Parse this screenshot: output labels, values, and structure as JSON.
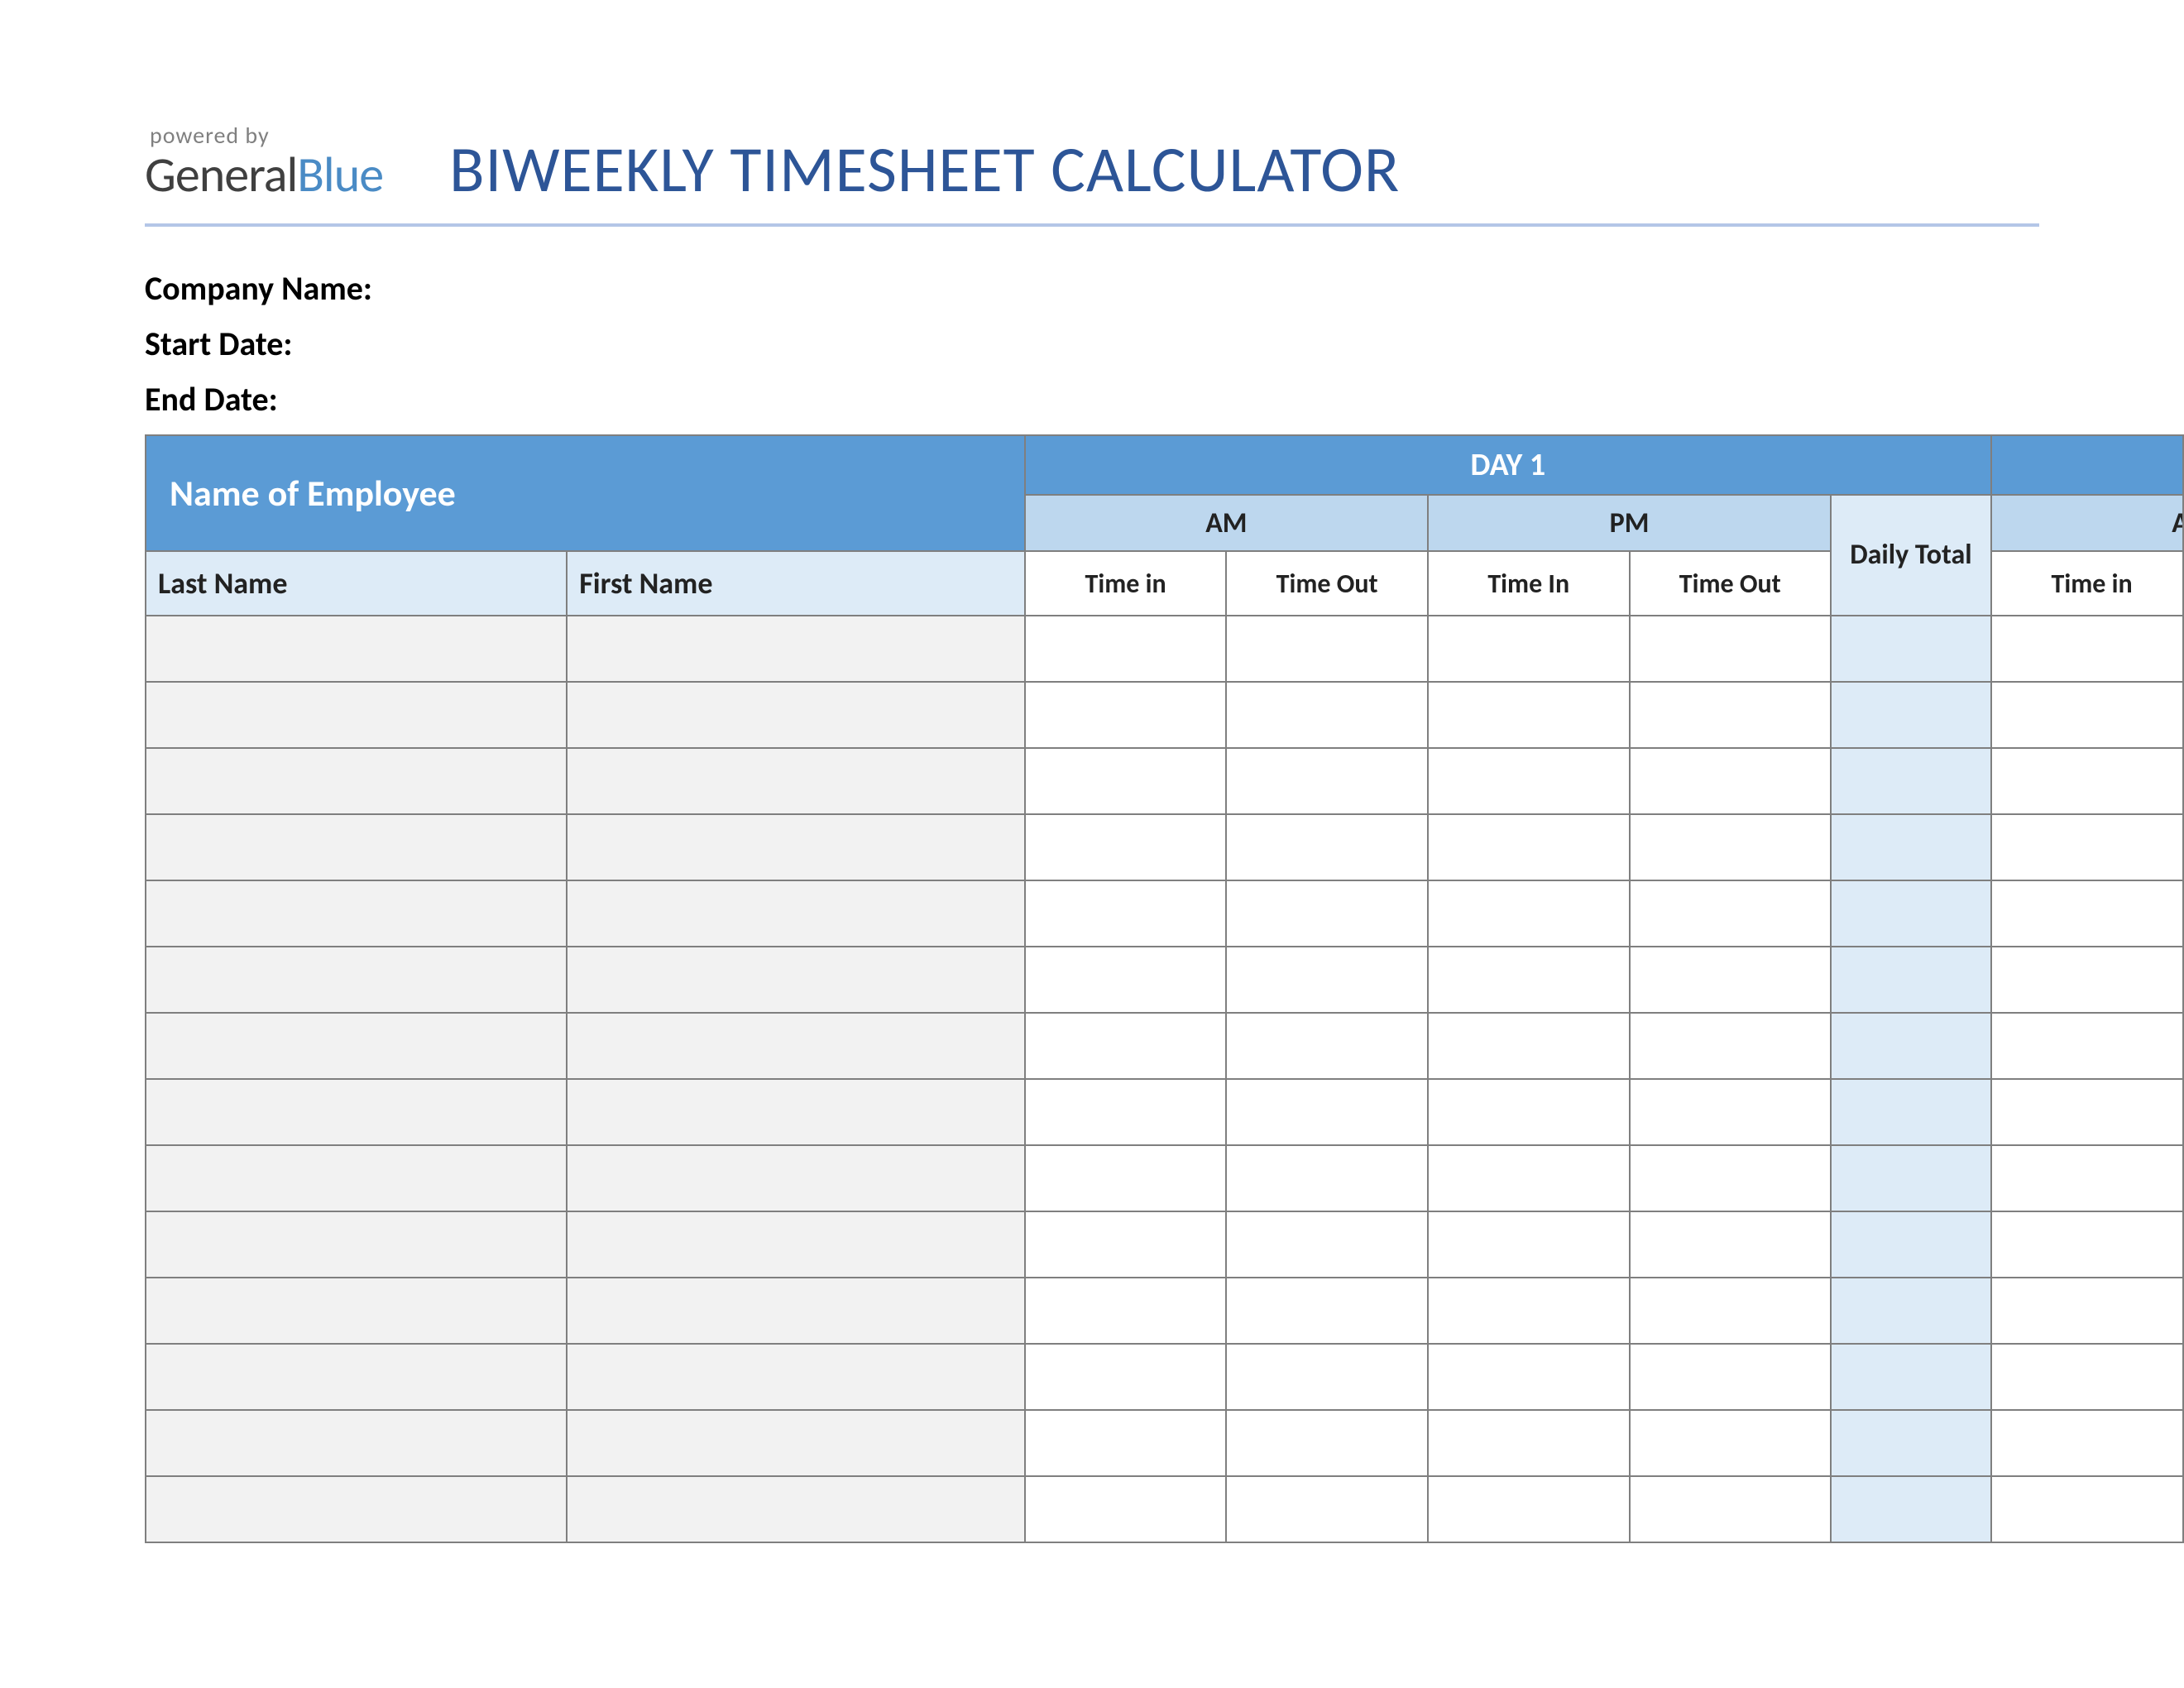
{
  "branding": {
    "powered_by": "powered by",
    "logo_general": "General",
    "logo_blue": "Blue"
  },
  "title": "BIWEEKLY TIMESHEET CALCULATOR",
  "meta": {
    "company_label": "Company Name:",
    "company_value": "",
    "start_label": "Start Date:",
    "start_value": "",
    "end_label": "End Date:",
    "end_value": ""
  },
  "headers": {
    "name_of_employee": "Name of Employee",
    "day1": "DAY 1",
    "day2": "",
    "day2_next": "",
    "am": "AM",
    "pm": "PM",
    "daily_total": "Daily Total",
    "am2": "AM",
    "last_name": "Last Name",
    "first_name": "First Name",
    "time_in": "Time in",
    "time_out": "Time Out",
    "time_in_cap": "Time In",
    "time_out2": "Time Out",
    "time_in2": "Time in"
  },
  "rows": [
    {
      "last": "",
      "first": "",
      "am_in": "",
      "am_out": "",
      "pm_in": "",
      "pm_out": "",
      "total": "",
      "am_in2": ""
    },
    {
      "last": "",
      "first": "",
      "am_in": "",
      "am_out": "",
      "pm_in": "",
      "pm_out": "",
      "total": "",
      "am_in2": ""
    },
    {
      "last": "",
      "first": "",
      "am_in": "",
      "am_out": "",
      "pm_in": "",
      "pm_out": "",
      "total": "",
      "am_in2": ""
    },
    {
      "last": "",
      "first": "",
      "am_in": "",
      "am_out": "",
      "pm_in": "",
      "pm_out": "",
      "total": "",
      "am_in2": ""
    },
    {
      "last": "",
      "first": "",
      "am_in": "",
      "am_out": "",
      "pm_in": "",
      "pm_out": "",
      "total": "",
      "am_in2": ""
    },
    {
      "last": "",
      "first": "",
      "am_in": "",
      "am_out": "",
      "pm_in": "",
      "pm_out": "",
      "total": "",
      "am_in2": ""
    },
    {
      "last": "",
      "first": "",
      "am_in": "",
      "am_out": "",
      "pm_in": "",
      "pm_out": "",
      "total": "",
      "am_in2": ""
    },
    {
      "last": "",
      "first": "",
      "am_in": "",
      "am_out": "",
      "pm_in": "",
      "pm_out": "",
      "total": "",
      "am_in2": ""
    },
    {
      "last": "",
      "first": "",
      "am_in": "",
      "am_out": "",
      "pm_in": "",
      "pm_out": "",
      "total": "",
      "am_in2": ""
    },
    {
      "last": "",
      "first": "",
      "am_in": "",
      "am_out": "",
      "pm_in": "",
      "pm_out": "",
      "total": "",
      "am_in2": ""
    },
    {
      "last": "",
      "first": "",
      "am_in": "",
      "am_out": "",
      "pm_in": "",
      "pm_out": "",
      "total": "",
      "am_in2": ""
    },
    {
      "last": "",
      "first": "",
      "am_in": "",
      "am_out": "",
      "pm_in": "",
      "pm_out": "",
      "total": "",
      "am_in2": ""
    },
    {
      "last": "",
      "first": "",
      "am_in": "",
      "am_out": "",
      "pm_in": "",
      "pm_out": "",
      "total": "",
      "am_in2": ""
    },
    {
      "last": "",
      "first": "",
      "am_in": "",
      "am_out": "",
      "pm_in": "",
      "pm_out": "",
      "total": "",
      "am_in2": ""
    }
  ]
}
